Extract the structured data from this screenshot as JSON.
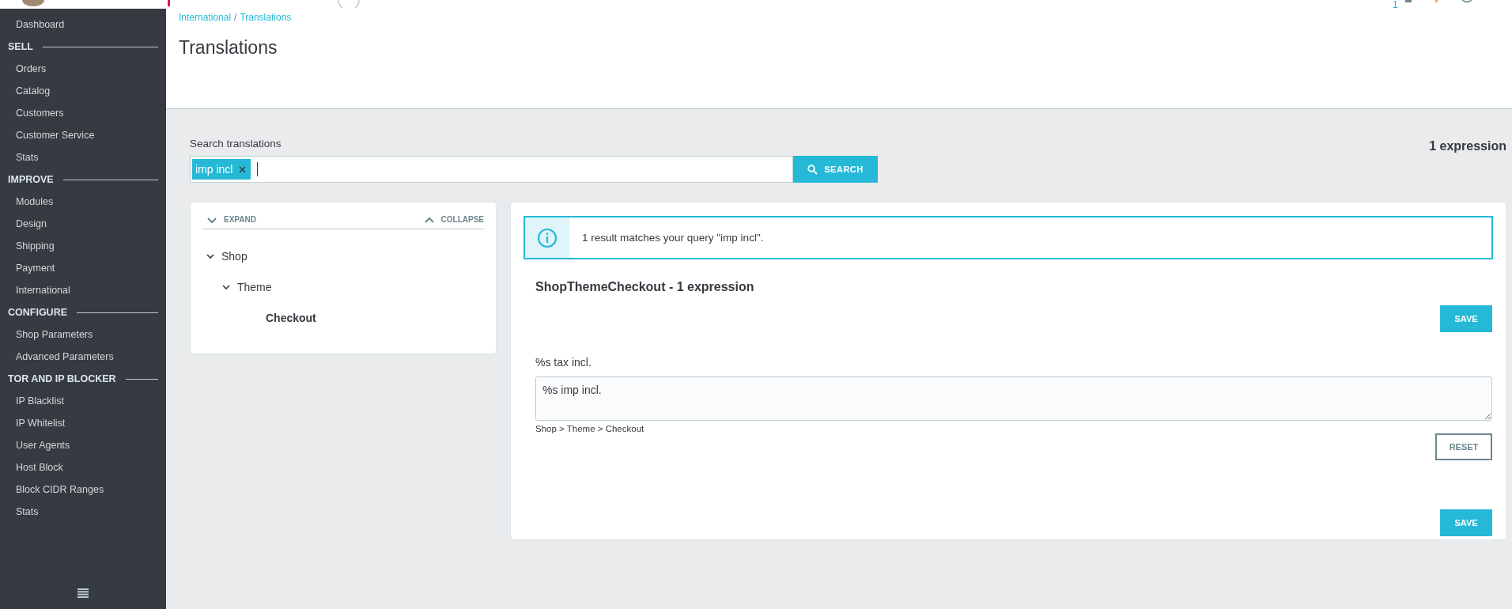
{
  "top_bar": {
    "notification_count": "1"
  },
  "sidebar": {
    "items": [
      {
        "kind": "link",
        "label": "Dashboard"
      },
      {
        "kind": "section",
        "label": "SELL"
      },
      {
        "kind": "link",
        "label": "Orders"
      },
      {
        "kind": "link",
        "label": "Catalog"
      },
      {
        "kind": "link",
        "label": "Customers"
      },
      {
        "kind": "link",
        "label": "Customer Service"
      },
      {
        "kind": "link",
        "label": "Stats"
      },
      {
        "kind": "section",
        "label": "IMPROVE"
      },
      {
        "kind": "link",
        "label": "Modules"
      },
      {
        "kind": "link",
        "label": "Design"
      },
      {
        "kind": "link",
        "label": "Shipping"
      },
      {
        "kind": "link",
        "label": "Payment"
      },
      {
        "kind": "link",
        "label": "International"
      },
      {
        "kind": "section",
        "label": "CONFIGURE"
      },
      {
        "kind": "link",
        "label": "Shop Parameters"
      },
      {
        "kind": "link",
        "label": "Advanced Parameters"
      },
      {
        "kind": "section",
        "label": "TOR AND IP BLOCKER"
      },
      {
        "kind": "link",
        "label": "IP Blacklist"
      },
      {
        "kind": "link",
        "label": "IP Whitelist"
      },
      {
        "kind": "link",
        "label": "User Agents"
      },
      {
        "kind": "link",
        "label": "Host Block"
      },
      {
        "kind": "link",
        "label": "Block CIDR Ranges"
      },
      {
        "kind": "link",
        "label": "Stats"
      }
    ]
  },
  "breadcrumb": {
    "items": [
      "International",
      "Translations"
    ],
    "separator": "/"
  },
  "page_title": "Translations",
  "search": {
    "label": "Search translations",
    "tags": [
      "imp incl"
    ],
    "button": "SEARCH"
  },
  "expression_count": "1 expression",
  "tree": {
    "expand": "EXPAND",
    "collapse": "COLLAPSE",
    "nodes": [
      {
        "label": "Shop",
        "expanded": true,
        "selected": false,
        "children": [
          {
            "label": "Theme",
            "expanded": true,
            "selected": false,
            "children": [
              {
                "label": "Checkout",
                "selected": true
              }
            ]
          }
        ]
      }
    ]
  },
  "results": {
    "info": "1 result matches your query \"imp incl\".",
    "domain_title": "ShopThemeCheckout - 1 expression",
    "save_button": "SAVE",
    "entries": [
      {
        "source": "%s tax incl.",
        "translation": "%s imp incl.",
        "path": "Shop > Theme > Checkout",
        "reset_button": "RESET"
      }
    ],
    "bottom_save_button": "SAVE"
  }
}
